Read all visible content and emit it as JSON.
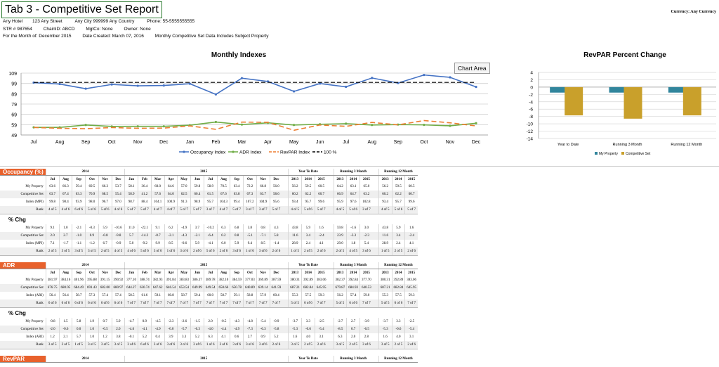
{
  "header": {
    "title": "Tab 3 - Competitive Set Report",
    "currency": "Currency: Any Currency",
    "hotel": "Any Hotel",
    "street": "123 Any Street",
    "city": "Any City 999999 Any Country",
    "phone": "Phone: 55-5555555555",
    "str": "STR # 987654",
    "chain": "ChainID: ABCD",
    "mgt": "MgtCo: None",
    "owner": "Owner: None",
    "month": "For the Month of: December 2015",
    "created": "Date Created: March 07, 2016",
    "note": "Monthly Competitive Set Data Includes Subject Property"
  },
  "tooltip": "Chart Area",
  "chart_data": [
    {
      "type": "line",
      "title": "Monthly Indexes",
      "categories": [
        "Jul",
        "Aug",
        "Sep",
        "Oct",
        "Nov",
        "Dec",
        "Jan",
        "Feb",
        "Mar",
        "Apr",
        "May",
        "Jun",
        "Jul",
        "Aug",
        "Sep",
        "Oct",
        "Nov",
        "Dec"
      ],
      "yticks": [
        49,
        59,
        69,
        79,
        89,
        99,
        109
      ],
      "ylim": [
        49,
        109
      ],
      "grid": true,
      "legend_position": "bottom",
      "series": [
        {
          "name": "Occupancy Index",
          "color": "#4472c4",
          "marker": "circle",
          "values": [
            99.8,
            98.4,
            93.9,
            98.0,
            96.7,
            97.0,
            98.7,
            88.4,
            104.1,
            100.9,
            91.3,
            98.9,
            95.7,
            104.3,
            99.4,
            107.2,
            104.9,
            95.6
          ]
        },
        {
          "name": "ADR Index",
          "color": "#70ad47",
          "marker": "circle",
          "values": [
            56.4,
            56.4,
            58.7,
            57.3,
            57.4,
            57.4,
            58.5,
            61.6,
            59.1,
            60.8,
            58.7,
            59.4,
            60.0,
            58.7,
            59.1,
            58.8,
            57.9,
            60.4
          ]
        },
        {
          "name": "RevPAR Index",
          "color": "#ed7d31",
          "dash": true,
          "values": [
            56.3,
            55.5,
            55.1,
            56.2,
            55.5,
            55.7,
            57.8,
            54.5,
            61.5,
            61.3,
            53.6,
            58.7,
            57.4,
            61.2,
            58.8,
            63.0,
            60.8,
            57.8
          ]
        },
        {
          "name": "100 %",
          "color": "#000000",
          "dash": true,
          "values": [
            100,
            100,
            100,
            100,
            100,
            100,
            100,
            100,
            100,
            100,
            100,
            100,
            100,
            100,
            100,
            100,
            100,
            100
          ]
        }
      ]
    },
    {
      "type": "bar",
      "title": "RevPAR Percent Change",
      "categories": [
        "Year to Date",
        "Running 3 Month",
        "Running 12 Month"
      ],
      "yticks": [
        4,
        2,
        0,
        -2,
        -4,
        -6,
        -8,
        -10,
        -12,
        -14
      ],
      "ylim": [
        -14,
        4
      ],
      "legend_position": "bottom",
      "series": [
        {
          "name": "My Property",
          "color": "#31859c",
          "values": [
            -1.5,
            -1.5,
            -1.5
          ]
        },
        {
          "name": "Competitive Set",
          "color": "#c9a02b",
          "values": [
            -7.7,
            -8.6,
            -7.7
          ]
        }
      ]
    }
  ],
  "tables": {
    "months": [
      "Jul",
      "Aug",
      "Sep",
      "Oct",
      "Nov",
      "Dec",
      "Jan",
      "Feb",
      "Mar",
      "Apr",
      "May",
      "Jun",
      "Jul",
      "Aug",
      "Sep",
      "Oct",
      "Nov",
      "Dec"
    ],
    "year1": "2014",
    "year2": "2015",
    "groups": [
      "Year To Date",
      "Running 3 Month",
      "Running 12 Month"
    ],
    "gyears": [
      "2013",
      "2014",
      "2015"
    ],
    "occupancy": {
      "label": "Occupancy (%)",
      "rows": [
        {
          "label": "My Property",
          "cells": [
            "63.6",
            "66.3",
            "59.4",
            "69.5",
            "66.3",
            "53.7",
            "58.1",
            "36.4",
            "60.0",
            "64.6",
            "57.0",
            "59.8",
            "58.9",
            "70.5",
            "63.4",
            "72.2",
            "66.8",
            "56.0"
          ],
          "g": [
            "56.2",
            "59.5",
            "60.5",
            "64.2",
            "63.1",
            "65.0",
            "56.2",
            "59.5",
            "60.5"
          ]
        },
        {
          "label": "Competitive Set",
          "cells": [
            "63.7",
            "67.4",
            "63.3",
            "70.9",
            "68.5",
            "55.4",
            "58.9",
            "41.2",
            "57.6",
            "64.0",
            "62.5",
            "60.4",
            "61.5",
            "67.6",
            "63.8",
            "67.3",
            "63.7",
            "58.6"
          ],
          "g": [
            "60.2",
            "62.2",
            "60.7",
            "66.9",
            "64.7",
            "63.2",
            "60.2",
            "62.2",
            "60.7"
          ]
        },
        {
          "label": "Index (MPI)",
          "cells": [
            "99.8",
            "98.4",
            "93.9",
            "98.0",
            "96.7",
            "97.0",
            "98.7",
            "88.4",
            "104.1",
            "100.9",
            "91.3",
            "98.9",
            "95.7",
            "104.3",
            "99.4",
            "107.2",
            "104.9",
            "95.6"
          ],
          "g": [
            "93.4",
            "95.7",
            "99.6",
            "95.9",
            "97.6",
            "102.8",
            "93.4",
            "95.7",
            "99.6"
          ]
        },
        {
          "label": "Rank",
          "cells": [
            "4 of 5",
            "4 of 6",
            "6 of 6",
            "5 of 6",
            "5 of 6",
            "4 of 6",
            "5 of 7",
            "5 of 7",
            "4 of 7",
            "4 of 7",
            "5 of 7",
            "5 of 7",
            "3 of 7",
            "4 of 7",
            "5 of 7",
            "3 of 7",
            "3 of 7",
            "5 of 7"
          ],
          "g": [
            "4 of 5",
            "5 of 6",
            "5 of 7",
            "4 of 5",
            "5 of 6",
            "3 of 7",
            "4 of 5",
            "5 of 6",
            "5 of 7"
          ]
        }
      ],
      "pct_label": "% Chg",
      "pct_rows": [
        {
          "label": "My Property",
          "cells": [
            "9.1",
            "1.0",
            "-2.1",
            "-0.3",
            "5.9",
            "-10.6",
            "11.0",
            "-22.1",
            "9.1",
            "6.2",
            "-4.9",
            "3.7",
            "-10.2",
            "6.3",
            "6.8",
            "3.8",
            "0.8",
            "4.3"
          ],
          "g": [
            "43.8",
            "5.9",
            "1.6",
            "59.8",
            "-1.6",
            "3.0",
            "43.8",
            "5.9",
            "1.6"
          ]
        },
        {
          "label": "Competitive Set",
          "cells": [
            "2.0",
            "2.7",
            "-1.0",
            "0.9",
            "-0.8",
            "-9.8",
            "5.7",
            "-14.2",
            "-0.7",
            "-2.1",
            "-4.3",
            "-2.1",
            "-6.4",
            "0.2",
            "0.8",
            "-5.1",
            "-7.1",
            "5.8"
          ],
          "g": [
            "11.6",
            "3.4",
            "-2.4",
            "23.9",
            "-3.3",
            "-2.3",
            "11.6",
            "3.4",
            "-2.4"
          ]
        },
        {
          "label": "Index (MPI)",
          "cells": [
            "7.1",
            "-1.7",
            "-1.1",
            "-1.2",
            "6.7",
            "-0.9",
            "5.0",
            "-9.2",
            "9.9",
            "8.5",
            "-0.6",
            "5.9",
            "-4.1",
            "6.0",
            "5.9",
            "9.4",
            "8.5",
            "-1.4"
          ],
          "g": [
            "28.9",
            "2.4",
            "4.1",
            "29.0",
            "1.8",
            "5.4",
            "28.9",
            "2.4",
            "4.1"
          ]
        },
        {
          "label": "Rank",
          "cells": [
            "2 of 5",
            "3 of 5",
            "3 of 5",
            "3 of 5",
            "2 of 5",
            "4 of 5",
            "4 of 6",
            "5 of 6",
            "3 of 6",
            "1 of 6",
            "3 of 6",
            "2 of 6",
            "5 of 6",
            "2 of 6",
            "3 of 6",
            "1 of 6",
            "3 of 6",
            "2 of 6"
          ],
          "g": [
            "1 of 5",
            "2 of 5",
            "2 of 6",
            "2 of 5",
            "4 of 5",
            "3 of 6",
            "1 of 5",
            "2 of 5",
            "2 of 6"
          ]
        }
      ]
    },
    "adr": {
      "label": "ADR",
      "rows": [
        {
          "label": "My Property",
          "cells": [
            "381.97",
            "384.16",
            "401.96",
            "395.88",
            "391.15",
            "390.92",
            "377.10",
            "388.74",
            "382.93",
            "391.84",
            "383.83",
            "386.37",
            "389.78",
            "382.10",
            "384.59",
            "377.03",
            "369.89",
            "387.59"
          ],
          "g": [
            "380.31",
            "392.89",
            "383.06",
            "382.37",
            "392.84",
            "377.70",
            "380.31",
            "392.89",
            "383.06"
          ]
        },
        {
          "label": "Competitive Set",
          "cells": [
            "676.75",
            "680.95",
            "684.49",
            "691.43",
            "682.00",
            "680.97",
            "644.27",
            "630.74",
            "647.62",
            "646.54",
            "653.54",
            "649.99",
            "649.54",
            "650.66",
            "650.78",
            "640.89",
            "639.14",
            "641.59"
          ],
          "g": [
            "687.21",
            "682.84",
            "645.95",
            "679.87",
            "684.93",
            "640.53",
            "687.21",
            "682.84",
            "645.95"
          ]
        },
        {
          "label": "Index (ARI)",
          "cells": [
            "56.4",
            "56.4",
            "58.7",
            "57.3",
            "57.4",
            "57.4",
            "58.5",
            "61.6",
            "59.1",
            "60.8",
            "58.7",
            "59.4",
            "60.0",
            "58.7",
            "59.1",
            "58.8",
            "57.9",
            "60.4"
          ],
          "g": [
            "55.3",
            "57.5",
            "59.3",
            "56.2",
            "57.4",
            "59.0",
            "55.3",
            "57.5",
            "59.3"
          ]
        },
        {
          "label": "Rank",
          "cells": [
            "6 of 6",
            "6 of 6",
            "6 of 6",
            "6 of 6",
            "6 of 6",
            "6 of 6",
            "7 of 7",
            "7 of 7",
            "7 of 7",
            "7 of 7",
            "7 of 7",
            "7 of 7",
            "7 of 7",
            "7 of 7",
            "7 of 7",
            "7 of 7",
            "7 of 7",
            "7 of 7"
          ],
          "g": [
            "5 of 5",
            "6 of 6",
            "7 of 7",
            "5 of 5",
            "6 of 6",
            "7 of 7",
            "5 of 5",
            "6 of 6",
            "7 of 7"
          ]
        }
      ],
      "pct_label": "% Chg",
      "pct_rows": [
        {
          "label": "My Property",
          "cells": [
            "-0.8",
            "1.5",
            "5.8",
            "1.9",
            "0.7",
            "5.9",
            "-4.7",
            "0.9",
            "-4.5",
            "-2.3",
            "-2.6",
            "-1.5",
            "2.0",
            "-0.5",
            "-4.3",
            "-4.8",
            "-5.4",
            "-0.9"
          ],
          "g": [
            "-3.7",
            "3.3",
            "-2.5",
            "-2.7",
            "2.7",
            "-3.9",
            "-3.7",
            "3.3",
            "-2.5"
          ]
        },
        {
          "label": "Competitive Set",
          "cells": [
            "-2.0",
            "-0.6",
            "0.0",
            "1.0",
            "-0.5",
            "2.0",
            "-4.6",
            "-4.1",
            "-4.9",
            "-6.0",
            "-5.7",
            "-6.3",
            "-4.0",
            "-4.4",
            "-4.9",
            "-7.3",
            "-6.3",
            "-5.8"
          ],
          "g": [
            "-5.3",
            "-0.6",
            "-5.4",
            "-8.5",
            "0.7",
            "-6.5",
            "-5.3",
            "-0.6",
            "-5.4"
          ]
        },
        {
          "label": "Index (ARI)",
          "cells": [
            "1.2",
            "2.1",
            "5.7",
            "1.0",
            "1.2",
            "3.8",
            "-0.1",
            "5.2",
            "0.4",
            "3.9",
            "3.3",
            "5.2",
            "6.3",
            "4.1",
            "0.6",
            "2.7",
            "0.9",
            "5.2"
          ],
          "g": [
            "1.6",
            "4.0",
            "3.1",
            "6.3",
            "2.0",
            "2.8",
            "1.6",
            "4.0",
            "3.1"
          ]
        },
        {
          "label": "Rank",
          "cells": [
            "3 of 5",
            "3 of 5",
            "1 of 5",
            "3 of 5",
            "3 of 5",
            "3 of 5",
            "3 of 6",
            "6 of 6",
            "3 of 6",
            "3 of 6",
            "3 of 6",
            "3 of 6",
            "1 of 6",
            "3 of 6",
            "3 of 6",
            "3 of 6",
            "3 of 6",
            "2 of 6"
          ],
          "g": [
            "3 of 5",
            "2 of 5",
            "2 of 6",
            "3 of 5",
            "2 of 5",
            "3 of 6",
            "3 of 5",
            "2 of 5",
            "2 of 6"
          ]
        }
      ]
    },
    "revpar": {
      "label": "RevPAR"
    }
  }
}
